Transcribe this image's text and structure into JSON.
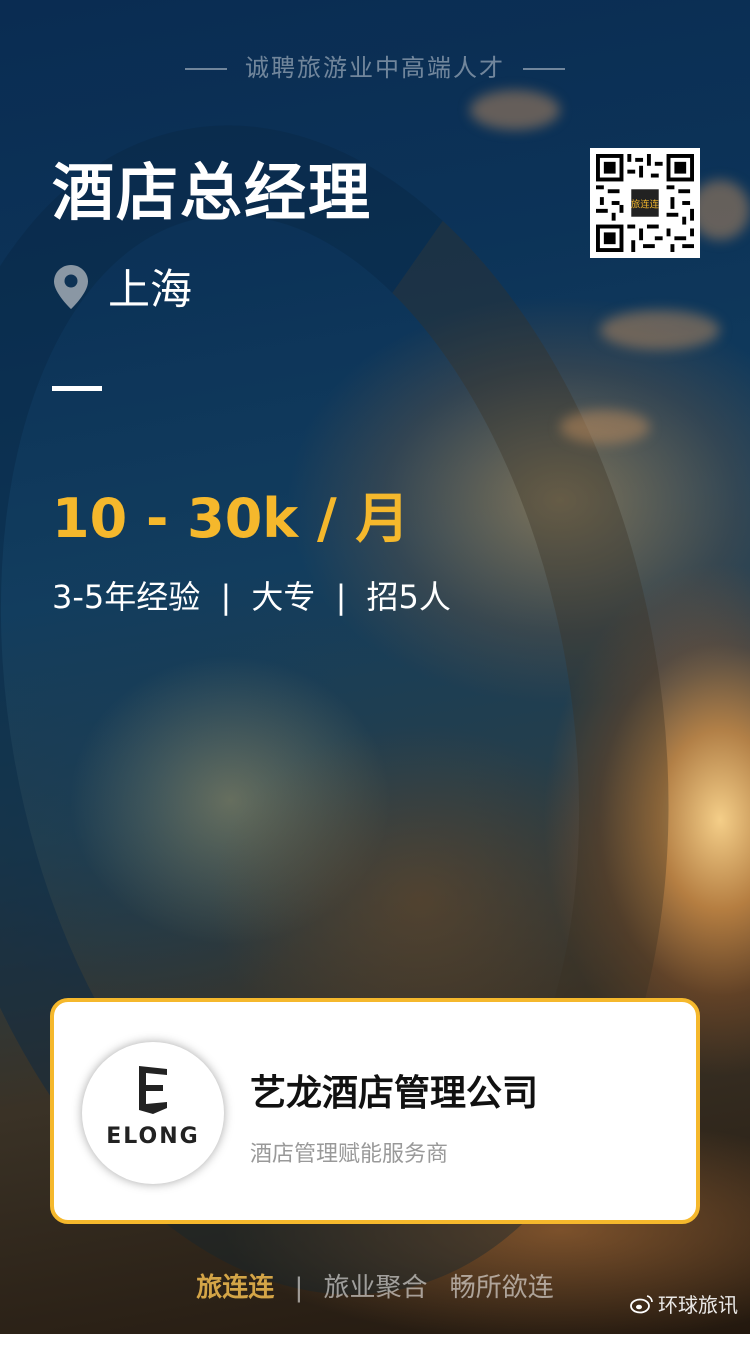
{
  "tagline": "诚聘旅游业中高端人才",
  "job": {
    "title": "酒店总经理",
    "location": "上海",
    "salary": "10 - 30k / 月",
    "experience": "3-5年经验",
    "education": "大专",
    "headcount": "招5人",
    "separator": "|"
  },
  "qr": {
    "label": "旅连连"
  },
  "company": {
    "name": "艺龙酒店管理公司",
    "tagline": "酒店管理赋能服务商",
    "logo_text": "ELONG"
  },
  "footer": {
    "brand": "旅连连",
    "separator": "|",
    "slogan_1": "旅业聚合",
    "slogan_2": "畅所欲连"
  },
  "watermark": {
    "text": "环球旅讯",
    "icon": "weibo-icon"
  },
  "colors": {
    "accent": "#f5b82c",
    "card_border": "#f5b82c",
    "brand_gold": "#d4a547"
  }
}
